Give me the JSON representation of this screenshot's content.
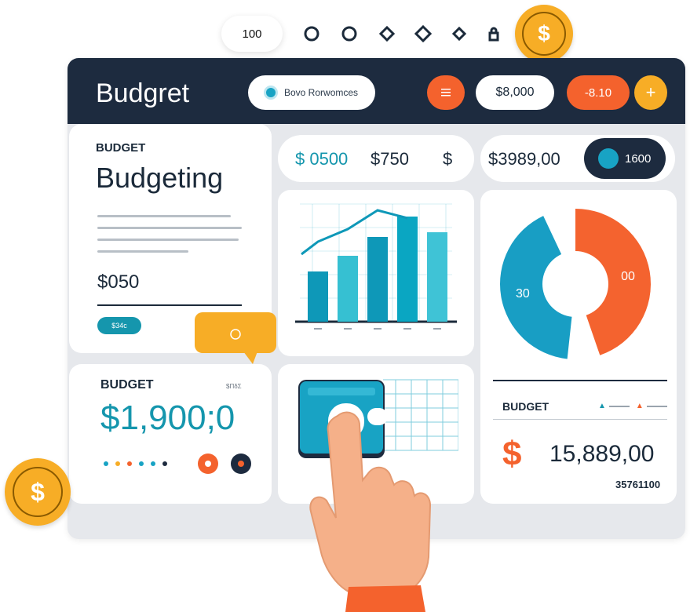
{
  "toolbar": {
    "zoom": "100",
    "icons": [
      "circle-icon",
      "circle-icon",
      "diamond-icon",
      "diamond-icon",
      "diamond-icon",
      "lock-icon"
    ]
  },
  "coins": {
    "symbol": "$"
  },
  "header": {
    "title": "Budgret",
    "search_text": "Bovo Rorwomces",
    "menu_icon": "hamburger-icon",
    "amount_pill": "$8,000",
    "minus_pill": "-8.10",
    "add_label": "+"
  },
  "budget_card": {
    "eyebrow": "BUDGET",
    "title": "Budgeting",
    "amount": "$050",
    "tag": "$34c"
  },
  "stats_bar": {
    "a": "$ 0500",
    "b": "$750",
    "c": "$"
  },
  "stats_right": {
    "total": "$3989,00",
    "pill_value": "1600"
  },
  "bar_chart": {
    "chart_data": {
      "type": "bar",
      "categories": [
        "",
        "",
        "",
        "",
        ""
      ],
      "values": [
        64,
        84,
        108,
        134,
        114
      ],
      "line": [
        102,
        118,
        142,
        132,
        0
      ]
    }
  },
  "donut": {
    "chart_data": {
      "type": "pie",
      "series": [
        {
          "label": "30",
          "value": 48,
          "color": "#189ec4"
        },
        {
          "label": "00",
          "value": 52,
          "color": "#f4632f"
        }
      ]
    }
  },
  "budget_card2": {
    "eyebrow": "BUDGET",
    "caption": "$ΠδΣ ",
    "amount": "$1,900;0",
    "dots": [
      "#18a3c4",
      "#f7ad26",
      "#f4622d",
      "#18a3c4",
      "#18a3c4",
      "#1d2b3f"
    ]
  },
  "summary": {
    "eyebrow": "BUDGET",
    "symbol": "$",
    "amount": "15,889,00",
    "sub": "35761100"
  },
  "colors": {
    "navy": "#1d2b3f",
    "teal": "#1596ad",
    "orange": "#f4622d",
    "gold": "#f7ad26"
  }
}
